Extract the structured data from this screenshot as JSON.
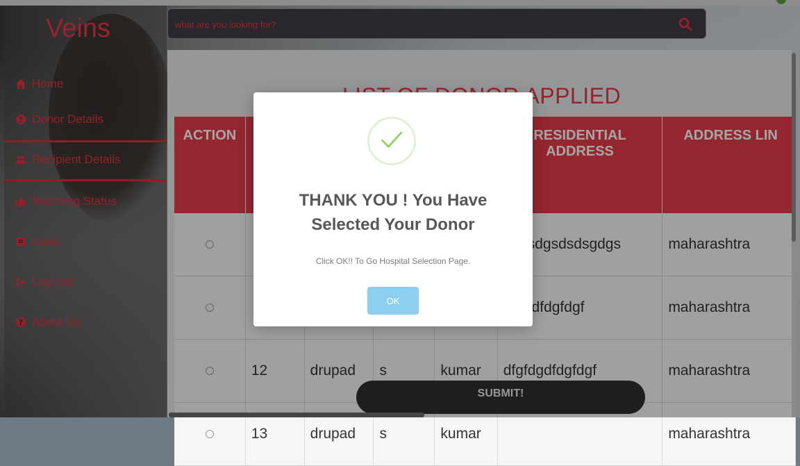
{
  "app": {
    "logo": "Veins"
  },
  "search": {
    "placeholder": "what are you looking for?"
  },
  "sidebar": {
    "items": [
      {
        "label": "Home",
        "icon": "home-icon"
      },
      {
        "label": "Donor Details",
        "icon": "user-circle-icon"
      },
      {
        "label": "Recipient Details",
        "icon": "users-icon"
      },
      {
        "label": "Matching Status",
        "icon": "thumbs-up-icon"
      },
      {
        "label": "Laws",
        "icon": "book-icon"
      },
      {
        "label": "Log Out",
        "icon": "sign-out-icon"
      },
      {
        "label": "About Us",
        "icon": "question-circle-icon"
      }
    ]
  },
  "main": {
    "title": "LIST OF DONOR APPLIED",
    "table": {
      "headers": [
        "ACTION",
        "",
        "",
        "",
        "",
        "RESIDENTIAL ADDRESS",
        "ADDRESS LIN"
      ],
      "rows": [
        [
          "",
          "",
          "",
          "",
          "",
          "ggdsdgsdsdsgdgs",
          "maharashtra"
        ],
        [
          "",
          "",
          "",
          "",
          "",
          "gfdgdfdgfdgf",
          "maharashtra"
        ],
        [
          "",
          "12",
          "drupad",
          "s",
          "kumar",
          "dfgfdgdfdgfdgf",
          "maharashtra"
        ],
        [
          "",
          "13",
          "drupad",
          "s",
          "kumar",
          "",
          "maharashtra"
        ]
      ]
    },
    "submit_label": "SUBMIT!"
  },
  "modal": {
    "title_line1": "THANK YOU ! You Have",
    "title_line2": "Selected Your Donor",
    "text": "Click OK!! To Go Hospital Selection Page.",
    "ok_label": "OK"
  },
  "colors": {
    "accent": "#e23b49",
    "success": "#8ecff0"
  }
}
